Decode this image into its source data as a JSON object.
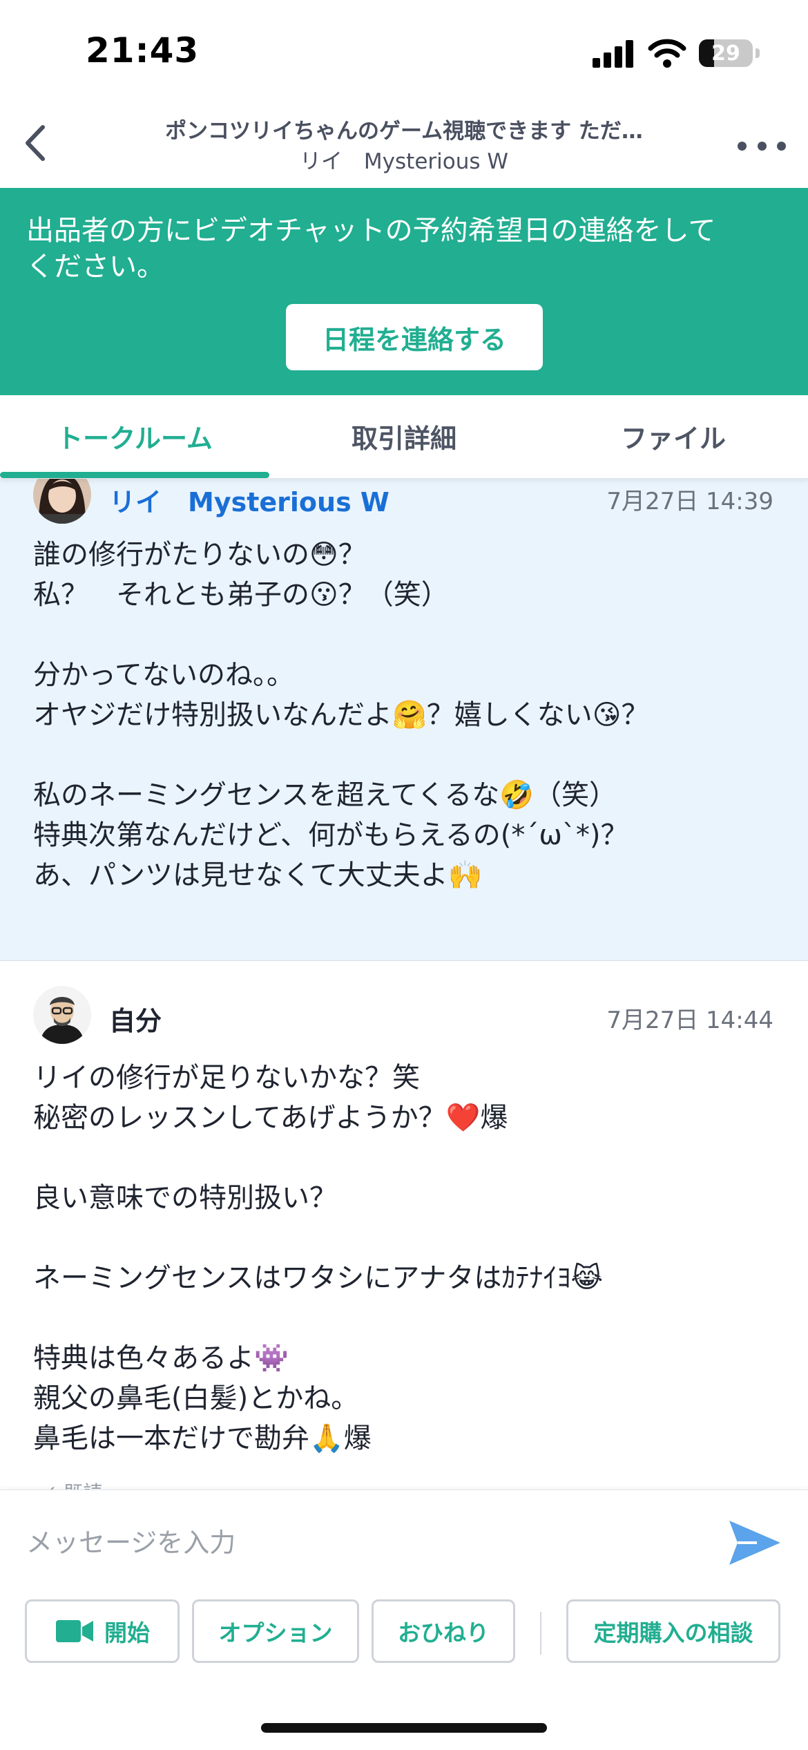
{
  "status_bar": {
    "time": "21:43",
    "battery": "29"
  },
  "header": {
    "title": "ポンコツリイちゃんのゲーム視聴できます ただ…",
    "subtitle": "リイ　Mysterious W"
  },
  "banner": {
    "text": "出品者の方にビデオチャットの予約希望日の連絡をしてください。",
    "button": "日程を連絡する",
    "color": "#21ae91"
  },
  "tabs": [
    {
      "label": "トークルーム",
      "active": true
    },
    {
      "label": "取引詳細",
      "active": false
    },
    {
      "label": "ファイル",
      "active": false
    }
  ],
  "messages": [
    {
      "sender": "リイ　Mysterious W",
      "timestamp": "7月27日 14:39",
      "body": "誰の修行がたりないの😳？\n私？　それとも弟子の😗？（笑）\n\n分かってないのね。。\nオヤジだけ特別扱いなんだよ🤗？嬉しくない😘？\n\n私のネーミングセンスを超えてくるな🤣（笑）\n特典次第なんだけど、何がもらえるの(*´ω`*)？\nあ、パンツは見せなくて大丈夫よ🙌"
    },
    {
      "sender": "自分",
      "timestamp": "7月27日 14:44",
      "body": "リイの修行が足りないかな？笑\n秘密のレッスンしてあげようか？❤️爆\n\n良い意味での特別扱い？\n\nネーミングセンスはワタシにアナタはｶﾃﾅｲﾖ😹\n\n特典は色々あるよ👾\n親父の鼻毛(白髪)とかね。\n鼻毛は一本だけで勘弁🙏爆",
      "read_status": "✓ 既読"
    }
  ],
  "composer": {
    "placeholder": "メッセージを入力",
    "buttons": {
      "start": "開始",
      "option": "オプション",
      "tip": "おひねり",
      "subscription": "定期購入の相談"
    }
  },
  "colors": {
    "accent": "#21ae91",
    "link": "#1a6fd6",
    "message_bg": "#eaf4fc",
    "send": "#5ba3ea"
  }
}
